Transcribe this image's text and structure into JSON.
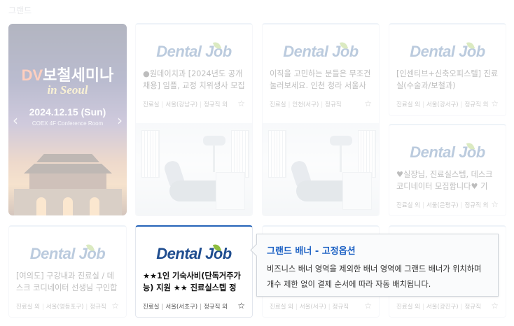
{
  "section_title": "그랜드",
  "promo": {
    "brand": "DV",
    "title": "보철세미나",
    "subtitle": "in Seoul",
    "date": "2024.12.15 (Sun)",
    "venue": "COEX 4F Conference Room",
    "prev_arrow": "‹",
    "next_arrow": "›"
  },
  "logo": {
    "text": "Dental Job"
  },
  "star_icon": "☆",
  "cards": [
    {
      "desc": "●원데이치과 [2024년도 공개채용] 임플, 교정 치위생사 모집 (...",
      "meta": [
        "진료실",
        "서울(강남구)",
        "정규직 외"
      ]
    },
    {
      "desc": "이직을 고민하는 분들은 무조건 눌러보세요. 인천 청라 서울사인치...",
      "meta": [
        "진료실",
        "인천(서구)",
        "정규직"
      ]
    },
    {
      "desc": "[인센티브+신축오피스텔] 진료실(수술과/보철과)",
      "meta": [
        "진료실 외",
        "서울(강서구)",
        "정규직 외"
      ]
    },
    {
      "desc": "♥실장님, 진료실스텝, 데스크코디네이터 모집합니다♥ 기숙...",
      "meta": [
        "진료실 외",
        "서울(은평구)",
        "정규직 외"
      ]
    },
    {
      "desc": "[여의도] 구강내과 진료실 / 데스크 코디네이터 선생님 구인합니다",
      "meta": [
        "진료실 외",
        "서울(영등포구)",
        "정규직"
      ]
    },
    {
      "desc": "★★1인 기숙사비(단독거주가능) 지원 ★★ 진료실스텝 정직...",
      "meta": [
        "진료실",
        "서울(서초구)",
        "정규직 외"
      ]
    },
    {
      "desc": "",
      "meta": [
        "진료실 외",
        "서울(서구)",
        "정규직"
      ]
    },
    {
      "desc": "",
      "meta": [
        "진료실 외",
        "서울(광진구)",
        "정규직"
      ]
    }
  ],
  "tooltip": {
    "title": "그랜드 배너 - 고정옵션",
    "line1": "비즈니스 배너 영역을 제외한 배너 영역에 그랜드 배너가 위치하며",
    "line2": "개수 제한 없이 결제 순서에 따라 자동 배치됩니다."
  }
}
